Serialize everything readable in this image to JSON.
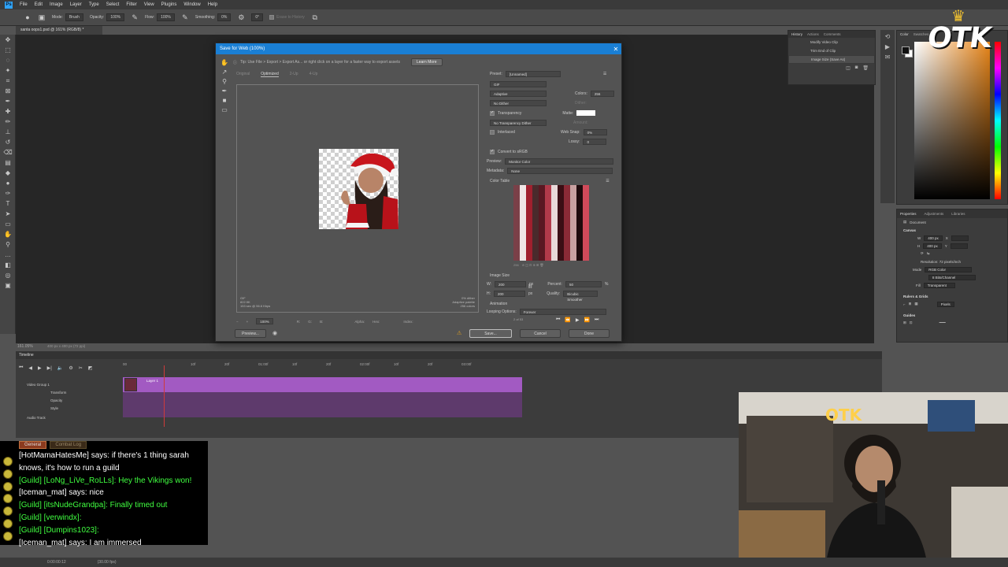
{
  "menubar": {
    "app_icon": "Ps",
    "items": [
      "File",
      "Edit",
      "Image",
      "Layer",
      "Type",
      "Select",
      "Filter",
      "View",
      "Plugins",
      "Window",
      "Help"
    ]
  },
  "options_bar": {
    "mode_label": "Mode:",
    "mode_value": "Brush",
    "opacity_label": "Opacity:",
    "opacity_value": "100%",
    "flow_label": "Flow:",
    "flow_value": "100%",
    "smoothing_label": "Smoothing:",
    "smoothing_value": "0%",
    "angle_value": "0°",
    "erase_history": "Erase to History"
  },
  "document_tab": "santa oops1.psd @ 161% (RGB/8) *",
  "history_panel": {
    "tabs": [
      "History",
      "Actions",
      "Comments"
    ],
    "items": [
      "Modify Video Clip",
      "Trim End of Clip",
      "Image Size (Save As)"
    ]
  },
  "color_panel": {
    "tabs": [
      "Color",
      "Swatches",
      "Gradients",
      "Patterns"
    ]
  },
  "properties_panel": {
    "tabs": [
      "Properties",
      "Adjustments",
      "Libraries"
    ],
    "document_label": "Document",
    "canvas_label": "Canvas",
    "w_label": "W",
    "w_value": "400 px",
    "h_label": "H",
    "h_value": "400 px",
    "x_label": "X",
    "y_label": "Y",
    "resolution": "Resolution: 72 pixels/inch",
    "mode_label": "Mode",
    "mode_value": "RGB Color",
    "depth_value": "8 Bits/Channel",
    "fill_label": "Fill",
    "fill_value": "Transparent",
    "rulers_label": "Rulers & Grids",
    "units_value": "Pixels",
    "guides_label": "Guides"
  },
  "zoom_readout": "161.05%",
  "doc_size_readout": "400 px x 400 px (72 ppi)",
  "dialog": {
    "title": "Save for Web (100%)",
    "tip": "Tip: Use File > Export > Export As... or right click on a layer for a faster way to export assets",
    "learn_more": "Learn More",
    "view_tabs": [
      "Original",
      "Optimized",
      "2-Up",
      "4-Up"
    ],
    "preview_info_left": [
      "GIF",
      "822.9K",
      "153 sec @ 56.6 Kbps"
    ],
    "preview_info_right": [
      "0% dither",
      "Adaptive palette",
      "256 colors"
    ],
    "preset_label": "Preset:",
    "preset_value": "[Unnamed]",
    "format_value": "GIF",
    "reduction_value": "Adaptive",
    "colors_label": "Colors:",
    "colors_value": "256",
    "dither_value": "No Dither",
    "dither_label": "Dither:",
    "transparency_label": "Transparency",
    "matte_label": "Matte:",
    "transparency_dither_value": "No Transparency Dither",
    "amount_label": "Amount:",
    "interlaced_label": "Interlaced",
    "web_snap_label": "Web Snap:",
    "web_snap_value": "0%",
    "lossy_label": "Lossy:",
    "lossy_value": "0",
    "convert_srgb_label": "Convert to sRGB",
    "preview_label": "Preview:",
    "preview_value": "Monitor Color",
    "metadata_label": "Metadata:",
    "metadata_value": "None",
    "color_table_label": "Color Table",
    "color_count": "256",
    "image_size_label": "Image Size",
    "w_label": "W:",
    "w_value": "200",
    "h_label": "H:",
    "h_value": "200",
    "px_label": "px",
    "percent_label": "Percent:",
    "percent_value": "50",
    "percent_unit": "%",
    "quality_label": "Quality:",
    "quality_value": "Bicubic Smoother",
    "animation_label": "Animation",
    "looping_label": "Looping Options:",
    "looping_value": "Forever",
    "frame_counter": "2 of 53",
    "zoom_value": "100%",
    "r_label": "R:",
    "g_label": "G:",
    "b_label": "B:",
    "alpha_label": "Alpha:",
    "hex_label": "Hex:",
    "index_label": "Index:",
    "preview_button": "Preview...",
    "save_button": "Save...",
    "cancel_button": "Cancel",
    "done_button": "Done"
  },
  "timeline": {
    "title": "Timeline",
    "ruler_labels": [
      "00",
      "",
      "10f",
      "20f",
      "01:00f",
      "10f",
      "20f",
      "02:00f",
      "10f",
      "20f",
      "03:00f"
    ],
    "group_label": "Video Group 1",
    "layer_label": "Layer 1",
    "props": [
      "Transform",
      "Opacity",
      "Style"
    ],
    "audio_label": "Audio Track",
    "time_readout": "0:00:00:12",
    "fps_readout": "(30.00 fps)"
  },
  "chat": {
    "tabs": [
      "General",
      "Combat Log"
    ],
    "lines": [
      {
        "type": "say",
        "text": "[HotMamaHatesMe] says: if there's 1 thing sarah"
      },
      {
        "type": "say",
        "text": "knows, it's how to run a guild"
      },
      {
        "type": "guild",
        "text": "[Guild] [LoNg_LiVe_RoLLs]: Hey the Vikings won!"
      },
      {
        "type": "say",
        "text": "[Iceman_mat] says: nice"
      },
      {
        "type": "guild",
        "text": "[Guild] [itsNudeGrandpa]: Finally timed out"
      },
      {
        "type": "guild",
        "text": "[Guild] [verwindx]:"
      },
      {
        "type": "guild",
        "text": "[Guild] [Dumpins1023]:"
      },
      {
        "type": "say",
        "text": "[Iceman_mat] says: I am immersed"
      }
    ]
  },
  "brand_logo": "OTK",
  "colors": {
    "accent_blue": "#1a7fd4",
    "track_purple": "#a25ac2",
    "guild_green": "#40ff40"
  }
}
